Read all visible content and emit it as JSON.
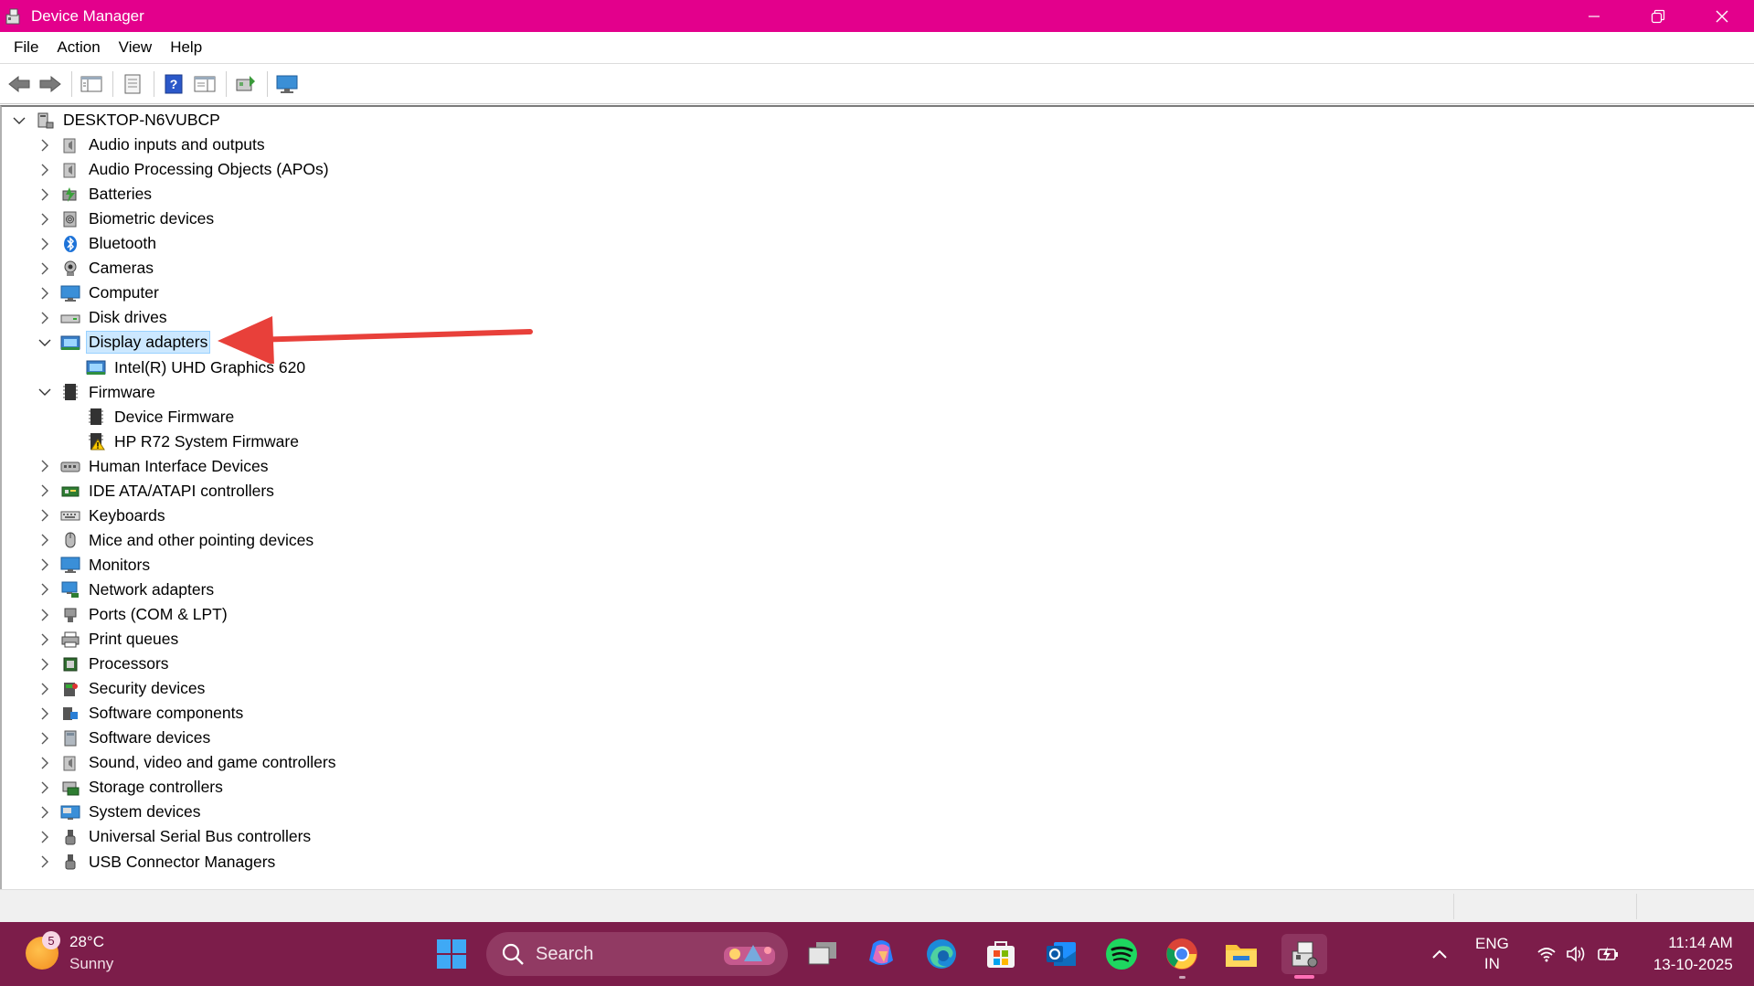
{
  "window": {
    "title": "Device Manager",
    "accent_color": "#e3008c"
  },
  "menu": [
    "File",
    "Action",
    "View",
    "Help"
  ],
  "toolbar_icons": [
    "back-icon",
    "forward-icon",
    "show-hide-console-tree-icon",
    "properties-icon",
    "help-icon",
    "action-pane-icon",
    "scan-hardware-icon",
    "monitor-icon"
  ],
  "tree": {
    "root": "DESKTOP-N6VUBCP",
    "items": [
      {
        "label": "Audio inputs and outputs",
        "icon": "speaker-icon",
        "level": 1,
        "expanded": false
      },
      {
        "label": "Audio Processing Objects (APOs)",
        "icon": "speaker-icon",
        "level": 1,
        "expanded": false
      },
      {
        "label": "Batteries",
        "icon": "battery-icon",
        "level": 1,
        "expanded": false
      },
      {
        "label": "Biometric devices",
        "icon": "fingerprint-icon",
        "level": 1,
        "expanded": false
      },
      {
        "label": "Bluetooth",
        "icon": "bluetooth-icon",
        "level": 1,
        "expanded": false
      },
      {
        "label": "Cameras",
        "icon": "camera-icon",
        "level": 1,
        "expanded": false
      },
      {
        "label": "Computer",
        "icon": "computer-icon",
        "level": 1,
        "expanded": false
      },
      {
        "label": "Disk drives",
        "icon": "disk-drive-icon",
        "level": 1,
        "expanded": false
      },
      {
        "label": "Display adapters",
        "icon": "display-adapter-icon",
        "level": 1,
        "expanded": true,
        "selected": true
      },
      {
        "label": "Intel(R) UHD Graphics 620",
        "icon": "display-adapter-icon",
        "level": 2
      },
      {
        "label": "Firmware",
        "icon": "firmware-icon",
        "level": 1,
        "expanded": true
      },
      {
        "label": "Device Firmware",
        "icon": "firmware-icon",
        "level": 2
      },
      {
        "label": "HP R72 System Firmware",
        "icon": "firmware-warning-icon",
        "level": 2
      },
      {
        "label": "Human Interface Devices",
        "icon": "hid-icon",
        "level": 1,
        "expanded": false
      },
      {
        "label": "IDE ATA/ATAPI controllers",
        "icon": "ide-controller-icon",
        "level": 1,
        "expanded": false
      },
      {
        "label": "Keyboards",
        "icon": "keyboard-icon",
        "level": 1,
        "expanded": false
      },
      {
        "label": "Mice and other pointing devices",
        "icon": "mouse-icon",
        "level": 1,
        "expanded": false
      },
      {
        "label": "Monitors",
        "icon": "monitor-icon",
        "level": 1,
        "expanded": false
      },
      {
        "label": "Network adapters",
        "icon": "network-adapter-icon",
        "level": 1,
        "expanded": false
      },
      {
        "label": "Ports (COM & LPT)",
        "icon": "port-icon",
        "level": 1,
        "expanded": false
      },
      {
        "label": "Print queues",
        "icon": "printer-icon",
        "level": 1,
        "expanded": false
      },
      {
        "label": "Processors",
        "icon": "processor-icon",
        "level": 1,
        "expanded": false
      },
      {
        "label": "Security devices",
        "icon": "security-device-icon",
        "level": 1,
        "expanded": false
      },
      {
        "label": "Software components",
        "icon": "software-component-icon",
        "level": 1,
        "expanded": false
      },
      {
        "label": "Software devices",
        "icon": "software-device-icon",
        "level": 1,
        "expanded": false
      },
      {
        "label": "Sound, video and game controllers",
        "icon": "speaker-icon",
        "level": 1,
        "expanded": false
      },
      {
        "label": "Storage controllers",
        "icon": "storage-controller-icon",
        "level": 1,
        "expanded": false
      },
      {
        "label": "System devices",
        "icon": "system-device-icon",
        "level": 1,
        "expanded": false
      },
      {
        "label": "Universal Serial Bus controllers",
        "icon": "usb-icon",
        "level": 1,
        "expanded": false
      },
      {
        "label": "USB Connector Managers",
        "icon": "usb-icon",
        "level": 1,
        "expanded": false
      }
    ]
  },
  "annotation_arrow_color": "#e8403a",
  "taskbar": {
    "weather": {
      "temp": "28°C",
      "condition": "Sunny",
      "badge": "5"
    },
    "search_placeholder": "Search",
    "apps": [
      "windows-start-icon",
      "task-view-icon",
      "copilot-icon",
      "edge-icon",
      "store-icon",
      "outlook-icon",
      "spotify-icon",
      "chrome-icon",
      "file-explorer-icon",
      "device-manager-icon"
    ],
    "tray": {
      "lang_line1": "ENG",
      "lang_line2": "IN",
      "time": "11:14 AM",
      "date": "13-10-2025"
    }
  }
}
